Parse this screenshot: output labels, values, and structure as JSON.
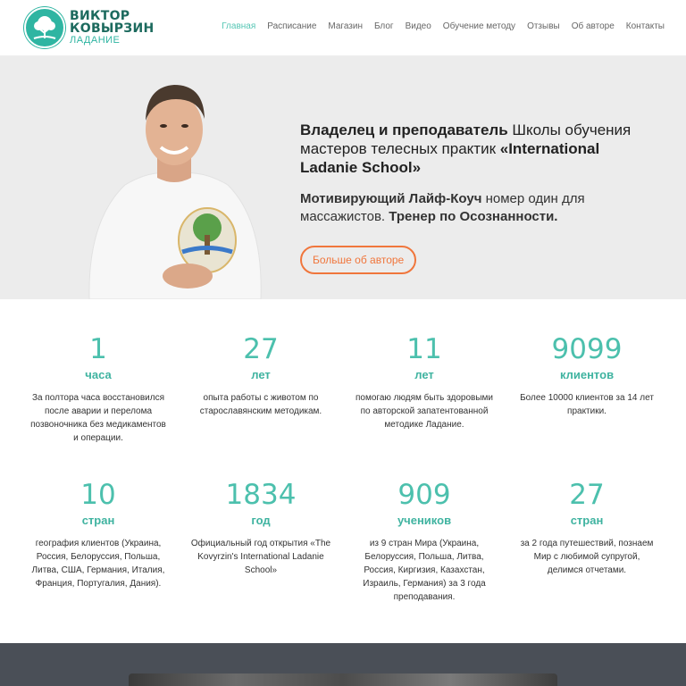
{
  "header": {
    "logo_line1": "ВИКТОР",
    "logo_line2": "КОВЫРЗИН",
    "logo_line3": "ЛАДАНИЕ",
    "nav": [
      "Главная",
      "Расписание",
      "Магазин",
      "Блог",
      "Видео",
      "Обучение методу",
      "Отзывы",
      "Об авторе",
      "Контакты"
    ],
    "active_nav": "Главная"
  },
  "hero": {
    "p1_bold1": "Владелец и преподаватель",
    "p1_text": " Школы обучения мастеров телесных практик ",
    "p1_bold2": "«International Ladanie School»",
    "p2_bold1": "Мотивирующий Лайф-Коуч",
    "p2_text": " номер один для массажистов. ",
    "p2_bold2": "Тренер по Осознанности.",
    "button": "Больше об авторе"
  },
  "stats": [
    {
      "num": "1",
      "unit": "часа",
      "desc": "За полтора часа восстановился после аварии и перелома позвоночника без медикаментов и операции."
    },
    {
      "num": "27",
      "unit": "лет",
      "desc": "опыта работы с животом по старославянским методикам."
    },
    {
      "num": "11",
      "unit": "лет",
      "desc": "помогаю людям быть здоровыми по авторской запатентованной методике Ладание."
    },
    {
      "num": "9099",
      "unit": "клиентов",
      "desc": "Более 10000 клиентов за 14 лет практики."
    },
    {
      "num": "10",
      "unit": "стран",
      "desc": "география клиентов (Украина, Россия, Белоруссия, Польша, Литва, США, Германия, Италия, Франция, Португалия, Дания)."
    },
    {
      "num": "1834",
      "unit": "год",
      "desc": "Официальный год открытия «The Kovyrzin's International Ladanie School»"
    },
    {
      "num": "909",
      "unit": "учеников",
      "desc": "из 9 стран Мира (Украина, Белоруссия, Польша, Литва, Россия, Киргизия, Казахстан, Израиль, Германия) за 3 года преподавания."
    },
    {
      "num": "27",
      "unit": "стран",
      "desc": "за 2 года путешествий, познаем Мир с любимой супругой, делимся отчетами."
    }
  ],
  "colors": {
    "accent": "#4cc0ad",
    "button": "#f0763c",
    "hero_bg": "#ececec",
    "footer_bg": "#4a4f57"
  },
  "icons": {
    "logo": "tree-logo-icon"
  }
}
